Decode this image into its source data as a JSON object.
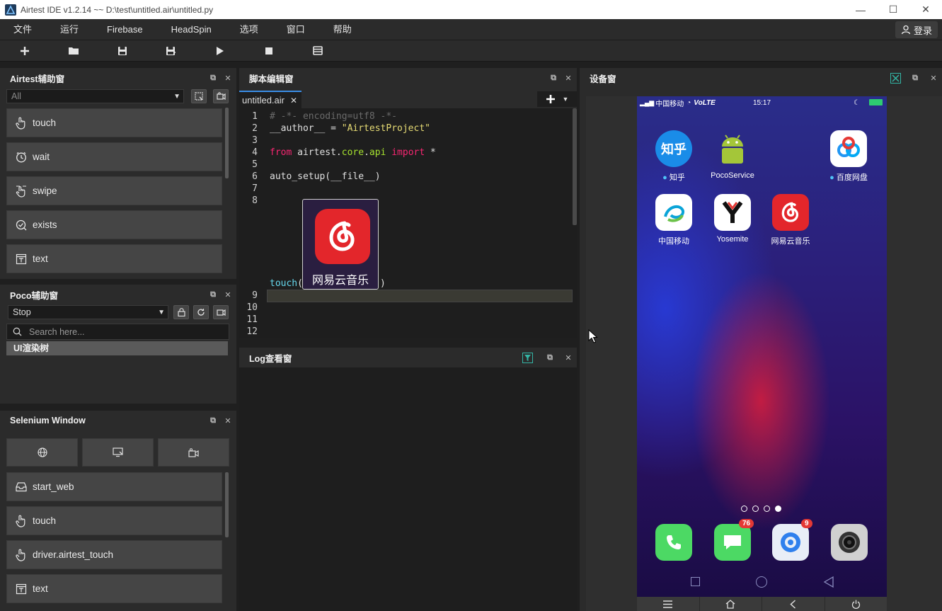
{
  "window": {
    "title": "Airtest IDE v1.2.14 ~~ D:\\test\\untitled.air\\untitled.py",
    "controls": [
      "—",
      "☐",
      "✕"
    ]
  },
  "menubar": {
    "items": [
      "文件",
      "运行",
      "Firebase",
      "HeadSpin",
      "选项",
      "窗口",
      "帮助"
    ],
    "login_label": "登录"
  },
  "airtest_panel": {
    "title": "Airtest辅助窗",
    "filter_value": "All",
    "commands": [
      "touch",
      "wait",
      "swipe",
      "exists",
      "text"
    ]
  },
  "poco_panel": {
    "title": "Poco辅助窗",
    "mode_value": "Stop",
    "search_placeholder": "Search here...",
    "tree_root": "UI渲染树"
  },
  "selenium_panel": {
    "title": "Selenium Window",
    "commands": [
      "start_web",
      "touch",
      "driver.airtest_touch",
      "text"
    ]
  },
  "editor": {
    "title": "脚本编辑窗",
    "tab_label": "untitled.air",
    "lines": {
      "l1": "# -*- encoding=utf8 -*-",
      "l2a": "__author__ = ",
      "l2b": "\"AirtestProject\"",
      "l4a": "from",
      "l4b": " airtest.",
      "l4c": "core",
      "l4d": ".",
      "l4e": "api",
      "l4f": " import",
      "l4g": " *",
      "l6": "auto_setup(__file__)",
      "l8a": "touch",
      "l8b": "(",
      "l8c": ")"
    },
    "line_numbers": [
      "1",
      "2",
      "3",
      "4",
      "5",
      "6",
      "7",
      "8",
      "9",
      "10",
      "11",
      "12"
    ],
    "template_image_label": "网易云音乐"
  },
  "log_panel": {
    "title": "Log查看窗"
  },
  "device_panel": {
    "title": "设备窗",
    "status_bar": {
      "carrier": "中国移动",
      "network": "VoLTE",
      "time": "15:17"
    },
    "apps_row1": [
      "知乎",
      "PocoService",
      "百度网盘"
    ],
    "apps_row2": [
      "中国移动",
      "Yosemite",
      "网易云音乐"
    ],
    "dock_badges": [
      "76",
      "9"
    ],
    "zhihu_icon_text": "知乎"
  },
  "colors": {
    "accent": "#3a8ee6",
    "netease_red": "#e3262b",
    "panel_bg": "#2b2b2b",
    "editor_bg": "#1e1e1e"
  }
}
